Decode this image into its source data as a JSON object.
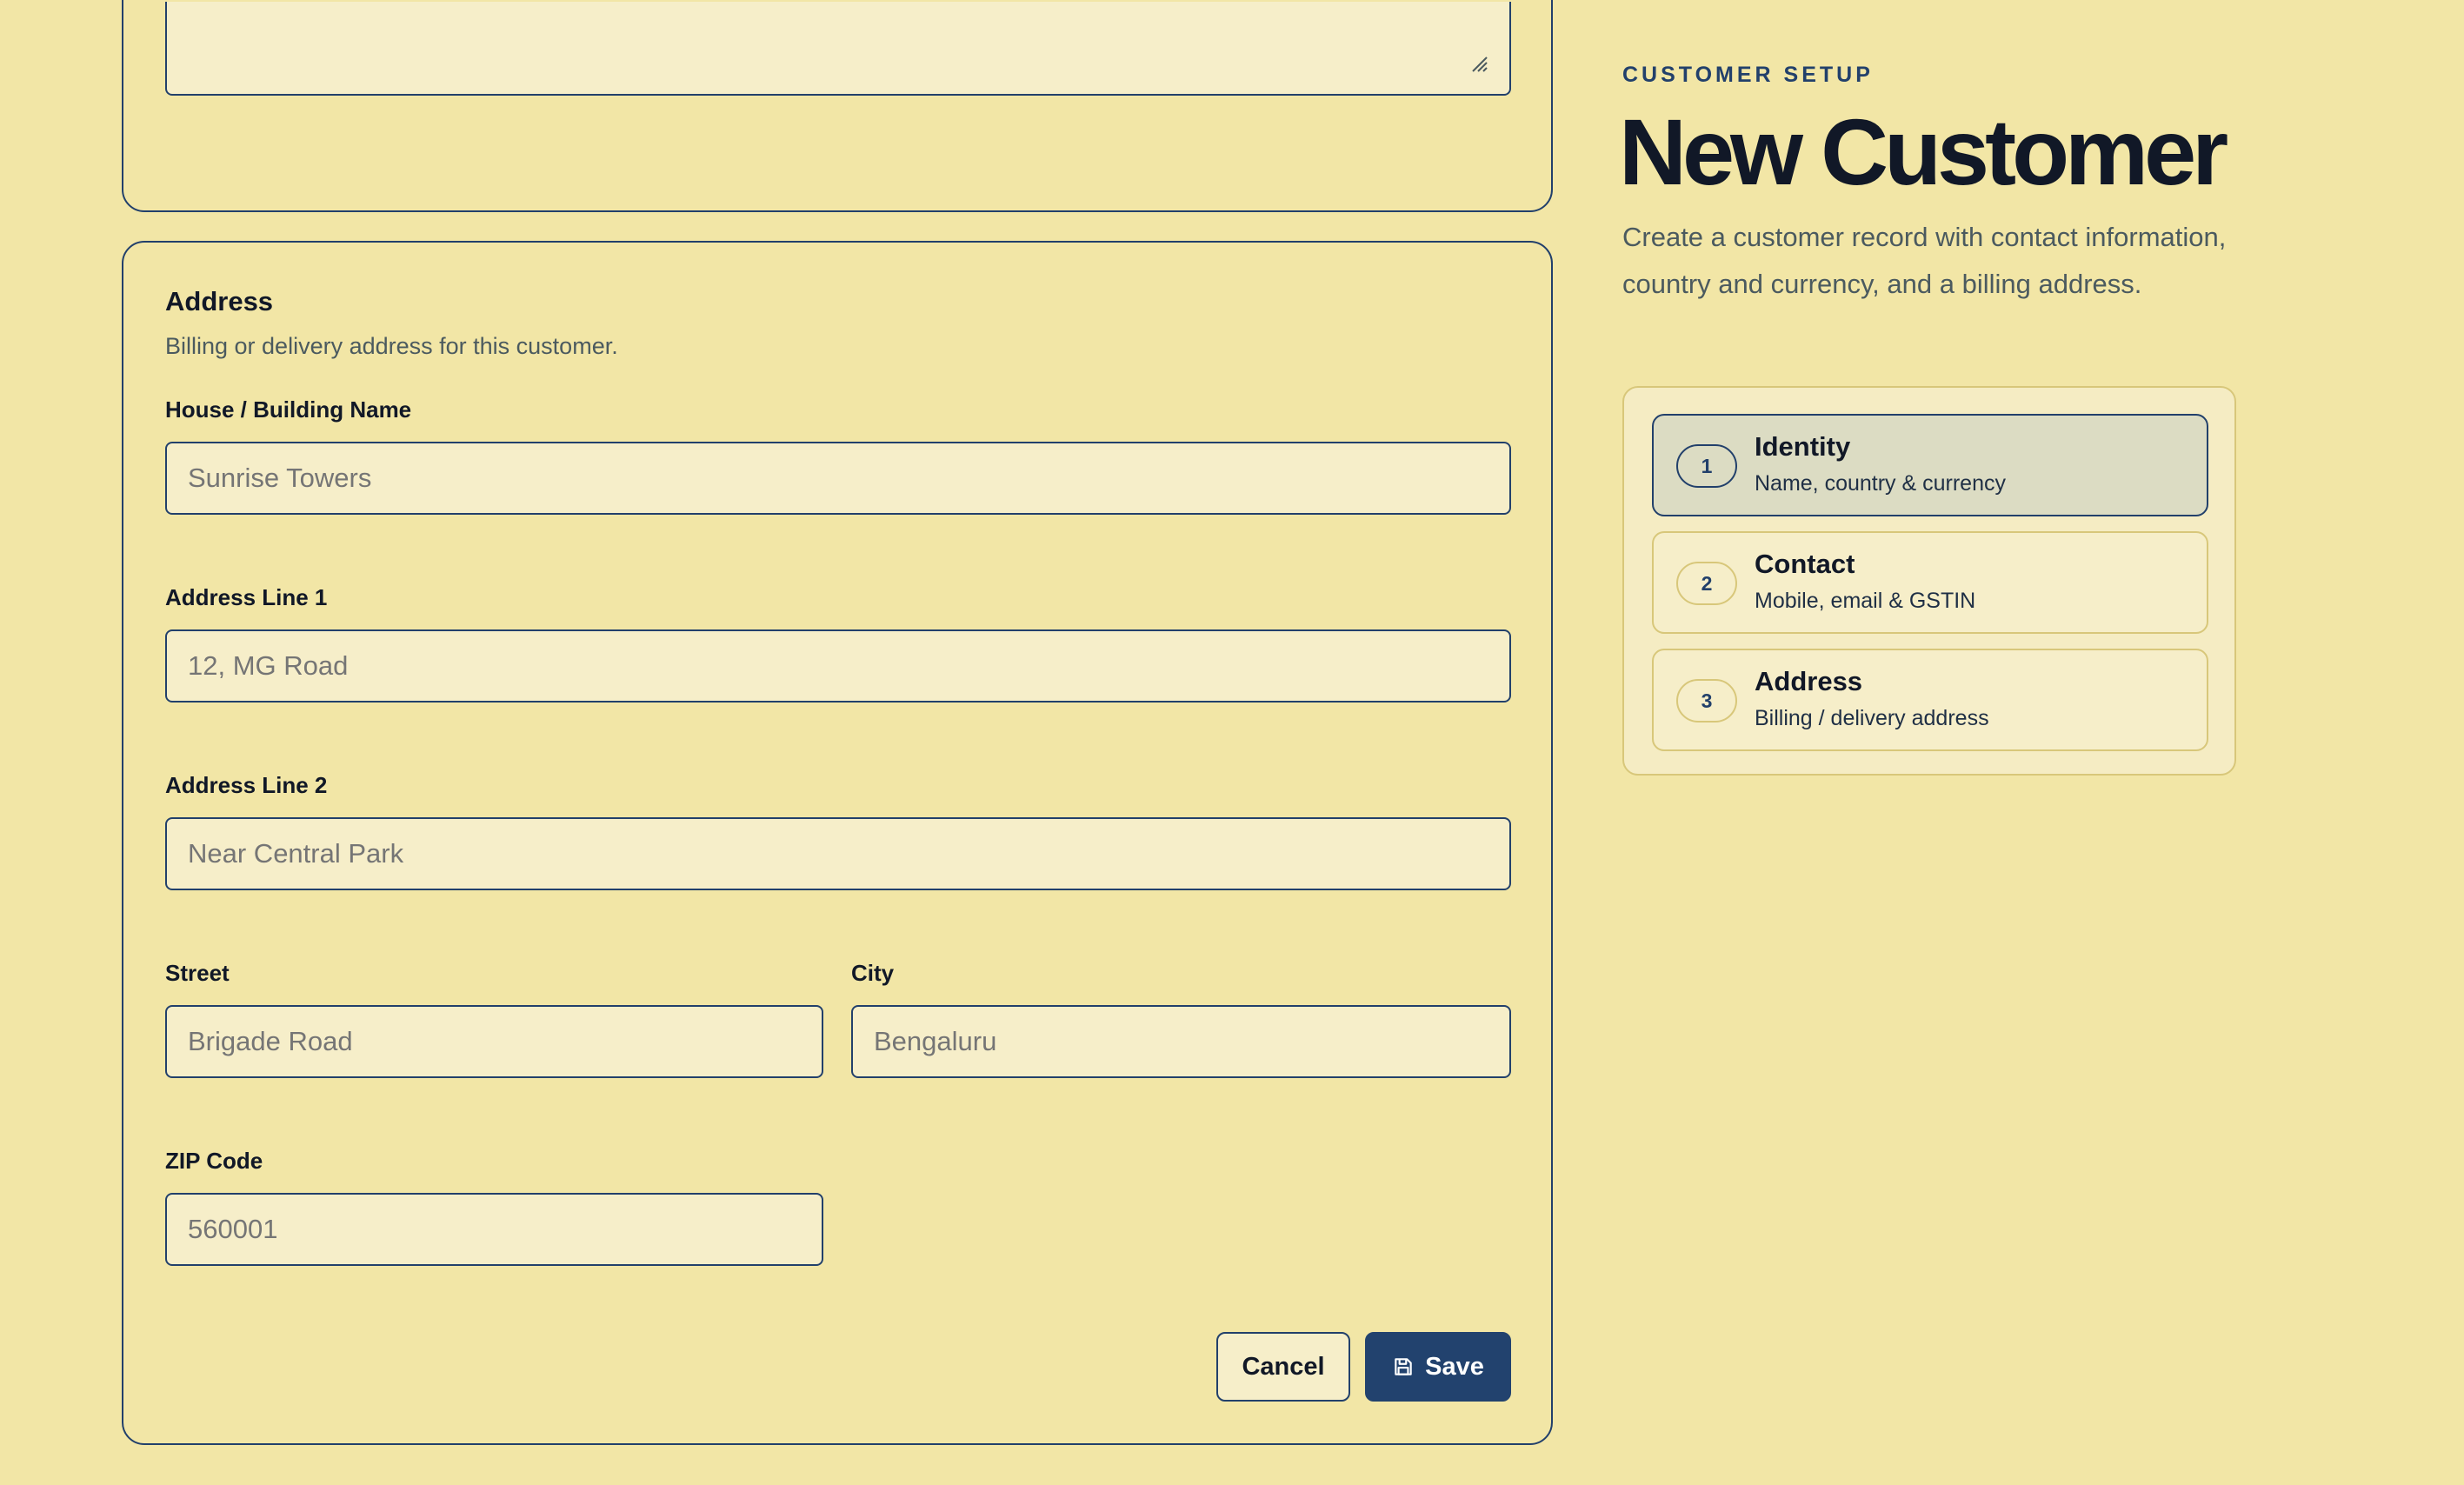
{
  "header": {
    "eyebrow": "CUSTOMER SETUP",
    "title": "New Customer",
    "subtitle": "Create a customer record with contact information, country and currency, and a billing address."
  },
  "steps": [
    {
      "number": "1",
      "title": "Identity",
      "subtitle": "Name, country & currency",
      "active": true
    },
    {
      "number": "2",
      "title": "Contact",
      "subtitle": "Mobile, email & GSTIN",
      "active": false
    },
    {
      "number": "3",
      "title": "Address",
      "subtitle": "Billing / delivery address",
      "active": false
    }
  ],
  "address": {
    "title": "Address",
    "description": "Billing or delivery address for this customer.",
    "fields": {
      "house": {
        "label": "House / Building Name",
        "placeholder": "Sunrise Towers"
      },
      "line1": {
        "label": "Address Line 1",
        "placeholder": "12, MG Road"
      },
      "line2": {
        "label": "Address Line 2",
        "placeholder": "Near Central Park"
      },
      "street": {
        "label": "Street",
        "placeholder": "Brigade Road"
      },
      "city": {
        "label": "City",
        "placeholder": "Bengaluru"
      },
      "zip": {
        "label": "ZIP Code",
        "placeholder": "560001"
      }
    }
  },
  "actions": {
    "cancel_label": "Cancel",
    "save_label": "Save"
  },
  "icons": {
    "save": "floppy-disk-icon",
    "resize": "resize-grip-icon"
  },
  "colors": {
    "background": "#f2e6a6",
    "accent": "#22426e",
    "input_bg": "#f6eec9",
    "active_step_bg": "#dcdcc3"
  }
}
